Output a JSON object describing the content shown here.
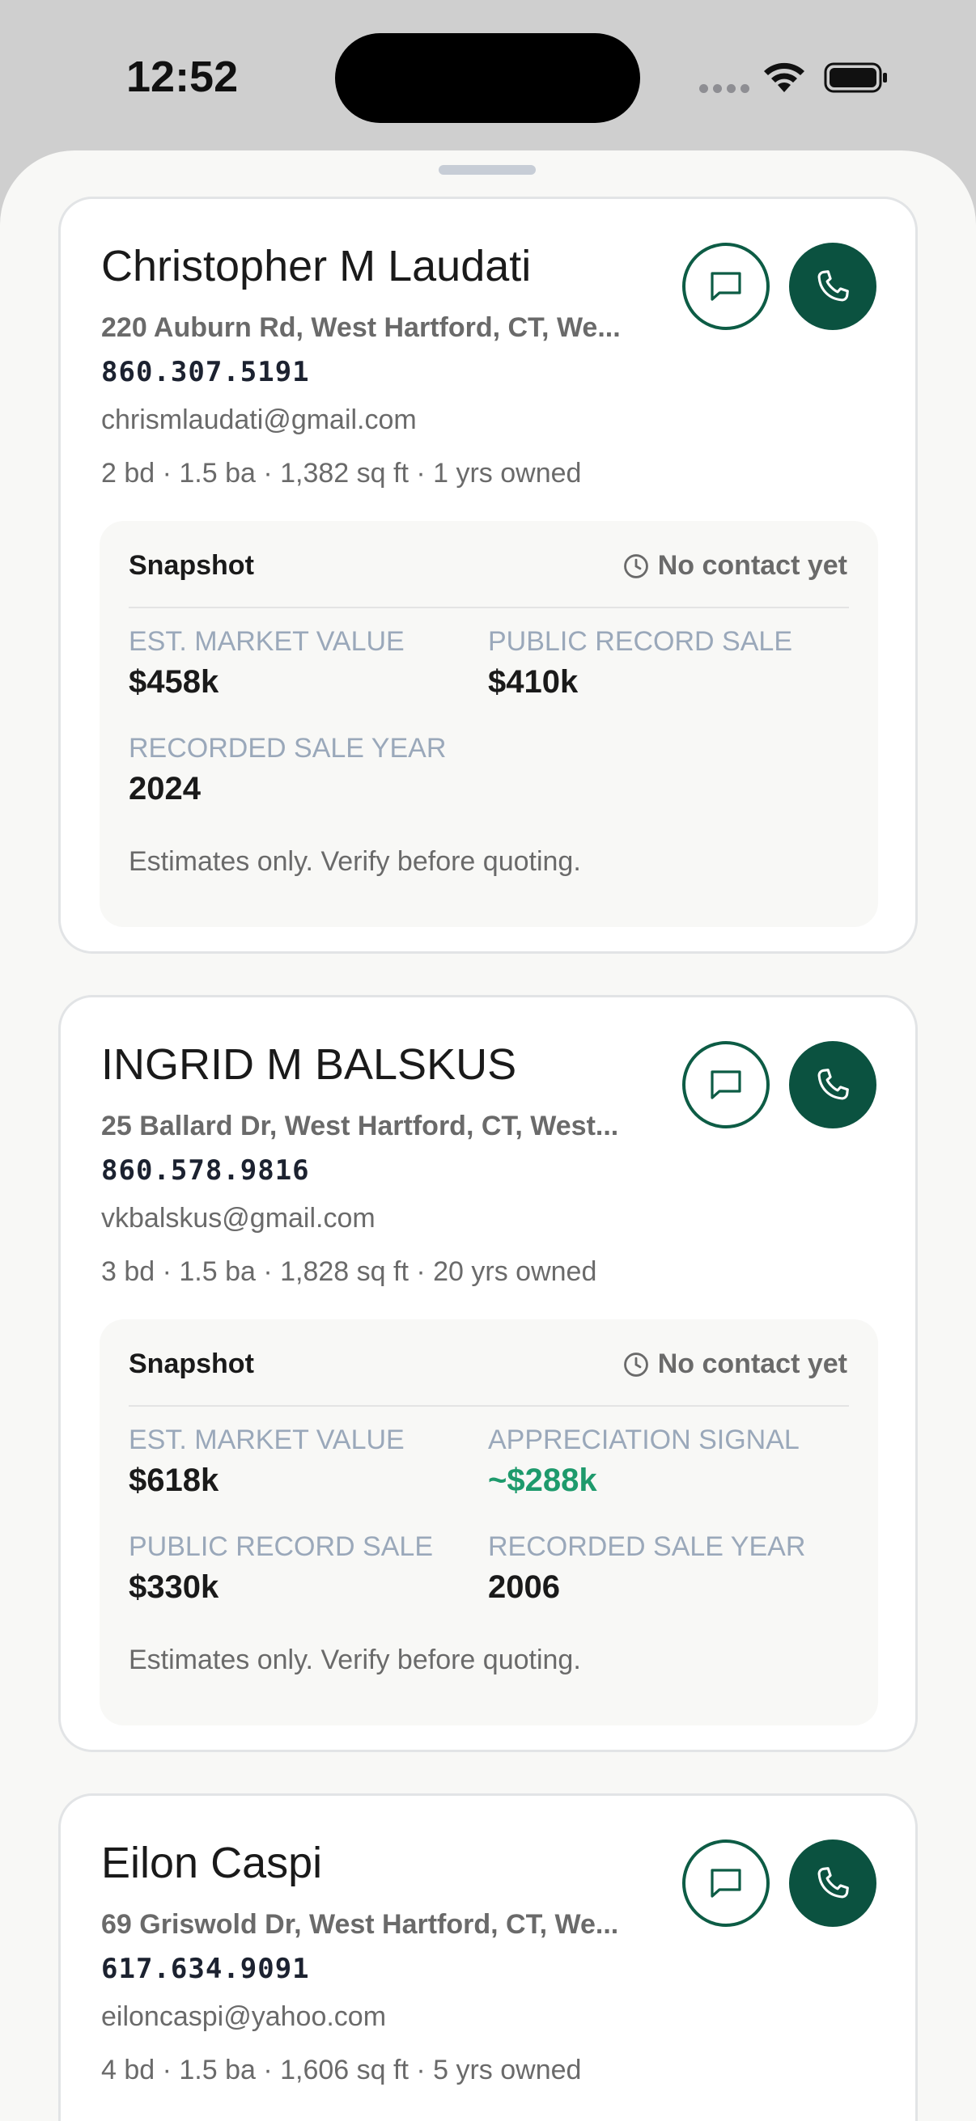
{
  "status_bar": {
    "time": "12:52",
    "icons": [
      "cellular-signal-icon",
      "wifi-icon",
      "battery-icon"
    ]
  },
  "colors": {
    "accent": "#0b5240",
    "positive": "#1e9a6c",
    "muted_label": "#9aa8ba"
  },
  "cards": [
    {
      "name": "Christopher M Laudati",
      "address": "220 Auburn Rd, West Hartford, CT, We...",
      "phone": "860.307.5191",
      "email": "chrismlaudati@gmail.com",
      "details": "2 bd · 1.5 ba · 1,382 sq ft · 1 yrs owned",
      "snapshot": {
        "title": "Snapshot",
        "status": "No contact yet",
        "metrics": [
          {
            "label": "EST. MARKET VALUE",
            "value": "$458k"
          },
          {
            "label": "PUBLIC RECORD SALE",
            "value": "$410k"
          },
          {
            "label": "RECORDED SALE YEAR",
            "value": "2024"
          }
        ],
        "note": "Estimates only. Verify before quoting."
      }
    },
    {
      "name": "INGRID M BALSKUS",
      "address": "25 Ballard Dr, West Hartford, CT, West...",
      "phone": "860.578.9816",
      "email": "vkbalskus@gmail.com",
      "details": "3 bd · 1.5 ba · 1,828 sq ft · 20 yrs owned",
      "snapshot": {
        "title": "Snapshot",
        "status": "No contact yet",
        "metrics": [
          {
            "label": "EST. MARKET VALUE",
            "value": "$618k"
          },
          {
            "label": "APPRECIATION SIGNAL",
            "value": "~$288k"
          },
          {
            "label": "PUBLIC RECORD SALE",
            "value": "$330k"
          },
          {
            "label": "RECORDED SALE YEAR",
            "value": "2006"
          }
        ],
        "note": "Estimates only. Verify before quoting."
      }
    },
    {
      "name": "Eilon Caspi",
      "address": "69 Griswold Dr, West Hartford, CT, We...",
      "phone": "617.634.9091",
      "email": "eiloncaspi@yahoo.com",
      "details": "4 bd · 1.5 ba · 1,606 sq ft · 5 yrs owned"
    }
  ]
}
